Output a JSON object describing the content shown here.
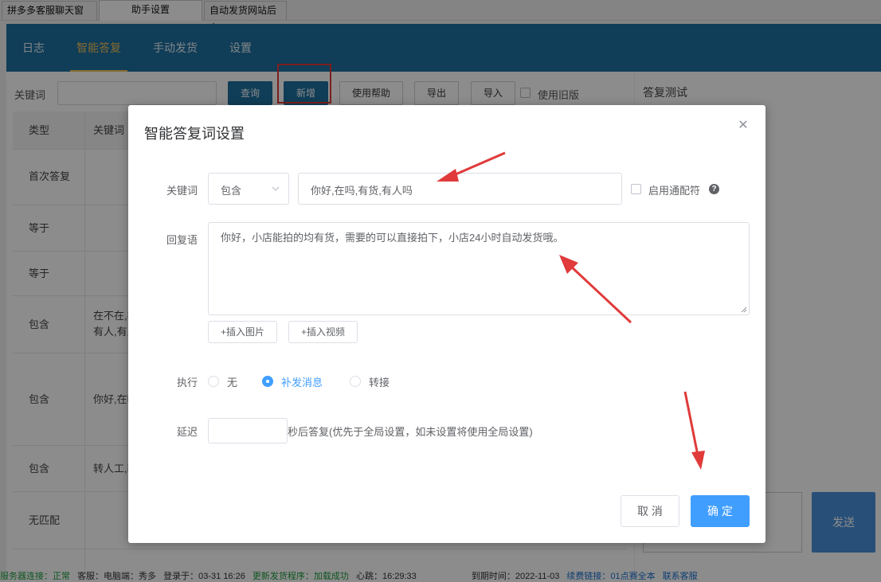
{
  "window_tabs": [
    "拼多多客服聊天窗口",
    "助手设置",
    "自动发货网站后台"
  ],
  "nav_tabs": [
    "日志",
    "智能答复",
    "手动发货",
    "设置"
  ],
  "toolbar": {
    "keyword_label": "关键词",
    "query_button": "查询",
    "add_button": "新增",
    "help_button": "使用帮助",
    "export_button": "导出",
    "import_button": "导入",
    "old_version_label": "使用旧版"
  },
  "right_panel": {
    "title": "答复测试",
    "send_button": "发送"
  },
  "table": {
    "headers": [
      "类型",
      "关键词"
    ],
    "rows": [
      {
        "type": "首次答复",
        "keyword": ""
      },
      {
        "type": "等于",
        "keyword": ""
      },
      {
        "type": "等于",
        "keyword": ""
      },
      {
        "type": "包含",
        "keyword": "在不在,在\n有人,有人"
      },
      {
        "type": "包含",
        "keyword": "你好,在吗"
      },
      {
        "type": "包含",
        "keyword": "转人工,转"
      },
      {
        "type": "无匹配",
        "keyword": ""
      }
    ]
  },
  "dialog": {
    "title": "智能答复词设置",
    "keyword_label": "关键词",
    "match_mode": "包含",
    "keyword_value": "你好,在吗,有货,有人吗",
    "wildcard_label": "启用通配符",
    "reply_label": "回复语",
    "reply_value": "你好，小店能拍的均有货，需要的可以直接拍下，小店24小时自动发货哦。",
    "insert_image": "+插入图片",
    "insert_video": "+插入视频",
    "execute_label": "执行",
    "execute_options": [
      "无",
      "补发消息",
      "转接"
    ],
    "execute_selected": "补发消息",
    "delay_label": "延迟",
    "delay_value": "",
    "delay_hint": "秒后答复(优先于全局设置，如未设置将使用全局设置)",
    "cancel_button": "取 消",
    "confirm_button": "确 定"
  },
  "status_bar": [
    "服务器连接：正常",
    "客服：电脑端：秀多",
    "登录于：03-31 16:26",
    "更新发货程序：加载成功",
    "心跳：16:29:33",
    "到期时间：2022-11-03",
    "续费链接：01点赛全本",
    "联系客服"
  ],
  "colors": {
    "nav_bg": "#1e6f9f",
    "nav_active": "#f0c35a",
    "primary": "#409eff",
    "annotation_red": "#e03a3a",
    "status_green": "#1a9a3a"
  }
}
